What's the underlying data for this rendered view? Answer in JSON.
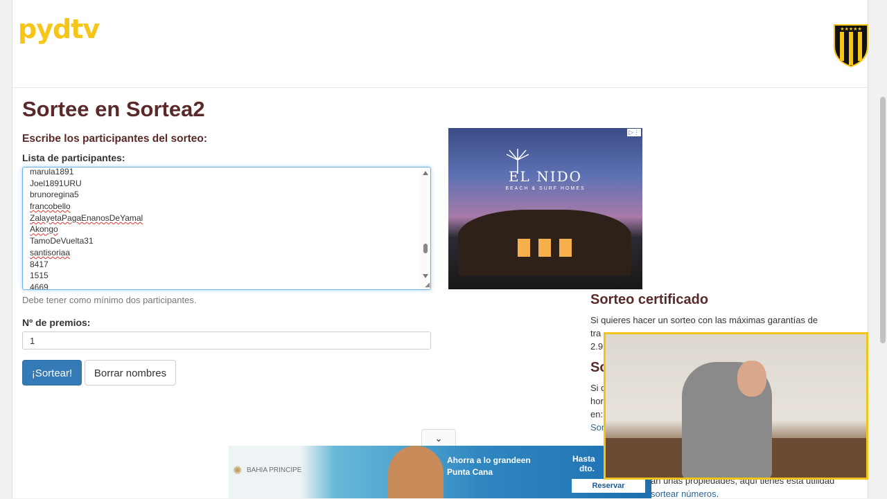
{
  "header": {
    "logo": "pydtv",
    "crest_icon": "club-crest-icon"
  },
  "main": {
    "title": "Sortee en Sortea2",
    "subtitle": "Escribe los participantes del sorteo:",
    "participants_label": "Lista de participantes:",
    "participants": [
      {
        "name": "marula1891",
        "spell": false
      },
      {
        "name": "Joel1891URU",
        "spell": false
      },
      {
        "name": "brunoregina5",
        "spell": false
      },
      {
        "name": "francobello",
        "spell": true
      },
      {
        "name": "ZalayetaPagaEnanosDeYamal",
        "spell": true
      },
      {
        "name": "Akongo",
        "spell": true
      },
      {
        "name": "TamoDeVuelta31",
        "spell": false
      },
      {
        "name": "santisoriaa",
        "spell": true
      },
      {
        "name": "8417",
        "spell": false
      },
      {
        "name": "1515",
        "spell": false
      },
      {
        "name": "4669",
        "spell": false
      }
    ],
    "help_text": "Debe tener como mínimo dos participantes.",
    "prizes_label": "Nº de premios:",
    "prizes_value": "1",
    "draw_button": "¡Sortear!",
    "clear_button": "Borrar nombres"
  },
  "ad_top": {
    "brand": "EL NIDO",
    "tagline": "BEACH & SURF HOMES"
  },
  "sidebar": {
    "certified_title": "Sorteo certificado",
    "certified_line1": "Si quieres hacer un sorteo con las máximas garantías de",
    "certified_line2": "tra",
    "certified_line3": "2.9",
    "section2_title_partial": "So",
    "section2_line1": "Si d",
    "section2_line2": "hor",
    "section2_line3": "en:",
    "section2_link": "Sor",
    "bottom_line": "an unas propiedades, aquí tienes esta utilidad",
    "bottom_link": "sortear números",
    "bottom_period": "."
  },
  "ad_bottom": {
    "brand": "BAHIA PRINCIPE",
    "line1": "Ahorra a lo grandeen",
    "line2": "Punta Cana",
    "hasta": "Hasta",
    "dto": "dto.",
    "cta": "Reservar"
  },
  "colors": {
    "logo": "#f5c518",
    "heading": "#5a2a2a",
    "primary": "#337ab7",
    "webcam_border": "#f0c419"
  }
}
